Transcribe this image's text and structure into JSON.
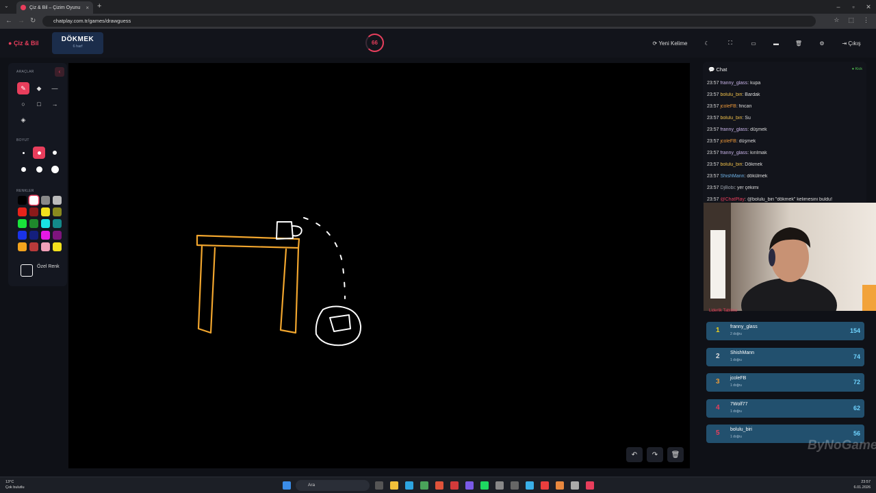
{
  "browser": {
    "tab_title": "Çiz & Bil – Çizim Oyunu",
    "url": "chatplay.com.tr/games/drawguess"
  },
  "header": {
    "logo": "Çiz & Bil",
    "word": "DÖKMEK",
    "word_sub": "6 harf",
    "timer": "66",
    "new_word": "Yeni Kelime",
    "exit": "Çıkış"
  },
  "tools": {
    "tools_label": "ARAÇLAR",
    "size_label": "BOYUT",
    "colors_label": "RENKLER",
    "custom_color": "Özel Renk",
    "colors": [
      "#000000",
      "#ffffff",
      "#888888",
      "#bbbbbb",
      "#e8231a",
      "#8b1a1a",
      "#f2e11d",
      "#8a8a1f",
      "#19e33b",
      "#1f8a2c",
      "#19e3e3",
      "#138a8a",
      "#1a33e8",
      "#141f7d",
      "#e619e6",
      "#7d147d",
      "#f2a31d",
      "#b83a3a",
      "#f2a0b8",
      "#f2e11d"
    ]
  },
  "chat": {
    "title": "Chat",
    "kick_label": "Kick",
    "messages": [
      {
        "time": "23:57",
        "user": "franny_glass",
        "color": "#c8b4e8",
        "text": ": kupa"
      },
      {
        "time": "23:57",
        "user": "bolulu_biri",
        "color": "#f0c04a",
        "text": ": Bardak"
      },
      {
        "time": "23:57",
        "user": "jcoleFB",
        "color": "#f09a3a",
        "text": ": fincan"
      },
      {
        "time": "23:57",
        "user": "bolulu_biri",
        "color": "#f0c04a",
        "text": ": Su"
      },
      {
        "time": "23:57",
        "user": "franny_glass",
        "color": "#c8b4e8",
        "text": ": düşmek"
      },
      {
        "time": "23:57",
        "user": "jcoleFB",
        "color": "#f09a3a",
        "text": ": düşmek"
      },
      {
        "time": "23:57",
        "user": "franny_glass",
        "color": "#c8b4e8",
        "text": ": kırılmak"
      },
      {
        "time": "23:57",
        "user": "bolulu_biri",
        "color": "#f0c04a",
        "text": ": Dökmek"
      },
      {
        "time": "23:57",
        "user": "ShishMann",
        "color": "#6fb3e8",
        "text": ": dökülmek"
      },
      {
        "time": "23:57",
        "user": "DjBobi",
        "color": "#9aa0aa",
        "text": ": yer çekimi"
      },
      {
        "time": "23:57",
        "user": "@ChatPlay",
        "color": "#e83e5c",
        "text": ": @bolulu_biri \"dökmek\" kelimesini buldu!"
      }
    ]
  },
  "leaderboard": {
    "title": "Liderlik Tablosu",
    "rows": [
      {
        "rank": "1",
        "name": "franny_glass",
        "sub": "2 doğru",
        "score": "154",
        "color": "#f2d21d"
      },
      {
        "rank": "2",
        "name": "ShishMann",
        "sub": "1 doğru",
        "score": "74",
        "color": "#dddddd"
      },
      {
        "rank": "3",
        "name": "jcoleFB",
        "sub": "1 doğru",
        "score": "72",
        "color": "#e89a3a"
      },
      {
        "rank": "4",
        "name": "7Wolf77",
        "sub": "1 doğru",
        "score": "62",
        "color": "#e83e5c"
      },
      {
        "rank": "5",
        "name": "bolulu_biri",
        "sub": "1 doğru",
        "score": "56",
        "color": "#e83e5c"
      }
    ]
  },
  "watermark": "ByNoGame",
  "taskbar": {
    "weather_temp": "13°C",
    "weather_desc": "Çok bulutlu",
    "search": "Ara",
    "time": "23:57",
    "date": "6.01.2026"
  }
}
